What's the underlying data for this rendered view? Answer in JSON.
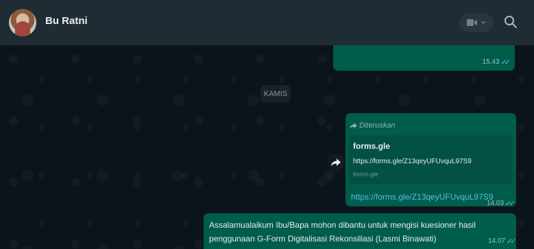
{
  "header": {
    "contact_name": "Bu Ratni",
    "icons": {
      "avatar": "contact-avatar",
      "video": "video-call-icon",
      "search": "search-icon"
    }
  },
  "chat": {
    "prev_message": {
      "time": "15.43"
    },
    "date_divider": "KAMIS",
    "forwarded": {
      "label": "Diteruskan",
      "preview_title": "forms.gle",
      "preview_url": "https://forms.gle/Z13qeyUFUvquL97S9",
      "preview_domain": "forms.gle",
      "link_text": "https://forms.gle/Z13qeyUFUvquL97S9",
      "time": "14.03"
    },
    "last_message": {
      "text": "Assalamualaikum Ibu/Bapa mohon dibantu untuk mengisi kuesioner hasil penggunaan G-Form Digitalisasi Rekonsiliasi (Lasmi Binawati)",
      "time": "14.07"
    }
  },
  "colors": {
    "header_bg": "#202c33",
    "chat_bg": "#0b141a",
    "outgoing_bubble": "#005c4b",
    "link_color": "#53bdeb",
    "read_ticks": "#53bdeb"
  }
}
